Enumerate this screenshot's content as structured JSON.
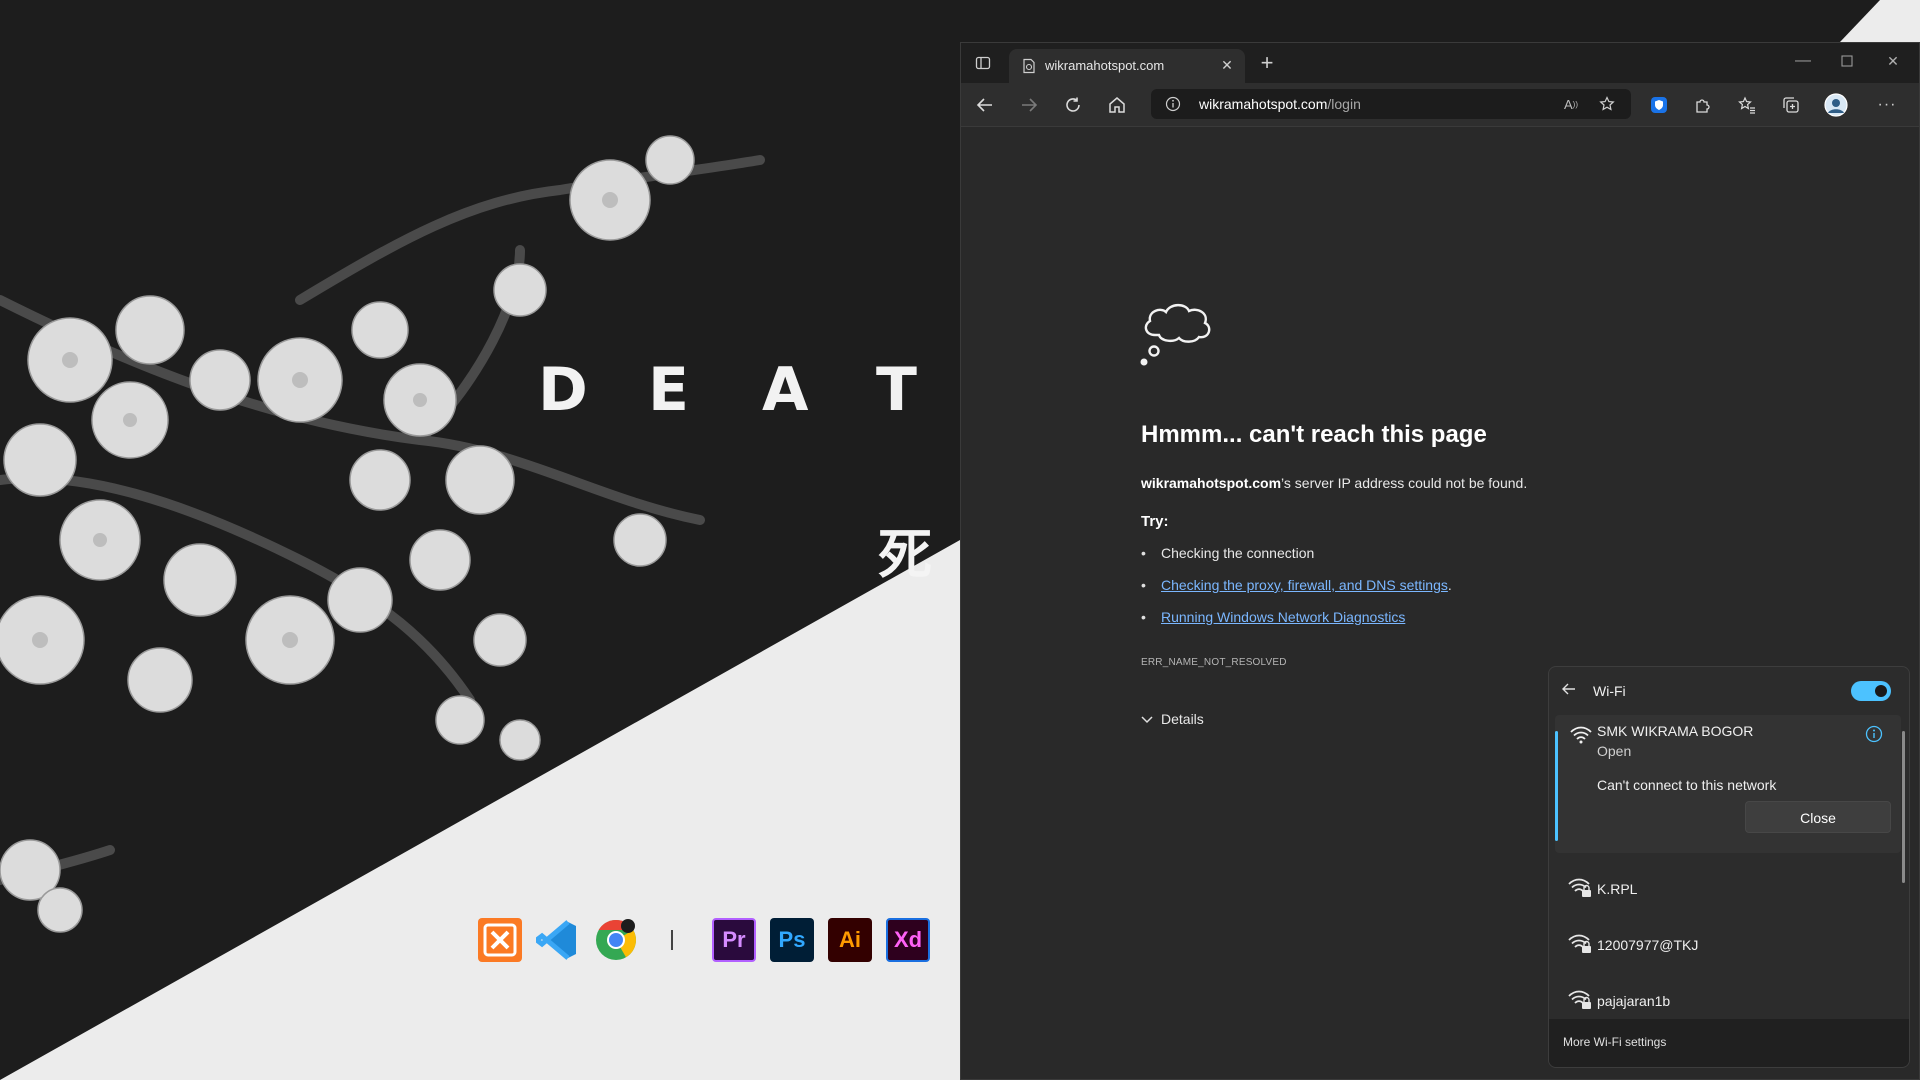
{
  "wallpaper": {
    "word_letters": [
      "D",
      "E",
      "A",
      "T"
    ],
    "kanji": "死"
  },
  "dock": {
    "icons": [
      {
        "name": "xampp-icon",
        "glyph": "ஐ",
        "color": "#f97316",
        "bg": "#fb7a24"
      },
      {
        "name": "vscode-icon",
        "glyph": "⋈",
        "color": "#2f9ef5",
        "bg": "transparent"
      },
      {
        "name": "chrome-icon",
        "glyph": "",
        "color": "#ffffff",
        "bg": "transparent"
      },
      {
        "name": "premiere-icon",
        "glyph": "Pr",
        "color": "#d58bff",
        "bg": "#2a0a3d"
      },
      {
        "name": "photoshop-icon",
        "glyph": "Ps",
        "color": "#31a8ff",
        "bg": "#001e36"
      },
      {
        "name": "illustrator-icon",
        "glyph": "Ai",
        "color": "#ff9a00",
        "bg": "#330000"
      },
      {
        "name": "xd-icon",
        "glyph": "Xd",
        "color": "#ff61f6",
        "bg": "#2e001e"
      }
    ]
  },
  "browser": {
    "tab": {
      "title": "wikramahotspot.com"
    },
    "address": {
      "host": "wikramahotspot.com",
      "path": "/login"
    },
    "accent": "#4aa3ff"
  },
  "error_page": {
    "title": "Hmmm... can't reach this page",
    "description_host": "wikramahotspot.com",
    "description_rest": "’s server IP address could not be found.",
    "try_label": "Try:",
    "suggestions": [
      {
        "text": "Checking the connection",
        "link": false,
        "suffix": ""
      },
      {
        "text": "Checking the proxy, firewall, and DNS settings",
        "link": true,
        "suffix": "."
      },
      {
        "text": "Running Windows Network Diagnostics",
        "link": true,
        "suffix": ""
      }
    ],
    "error_code": "ERR_NAME_NOT_RESOLVED",
    "details_label": "Details"
  },
  "wifi": {
    "title": "Wi-Fi",
    "toggle_on": true,
    "toggle_color": "#4cc2ff",
    "connected": {
      "ssid": "SMK WIKRAMA BOGOR",
      "status": "Open",
      "message": "Can't connect to this network",
      "close_label": "Close"
    },
    "networks": [
      {
        "ssid": "K.RPL",
        "secured": true
      },
      {
        "ssid": "12007977@TKJ",
        "secured": true
      },
      {
        "ssid": "pajajaran1b",
        "secured": true
      }
    ],
    "more_settings": "More Wi-Fi settings"
  }
}
